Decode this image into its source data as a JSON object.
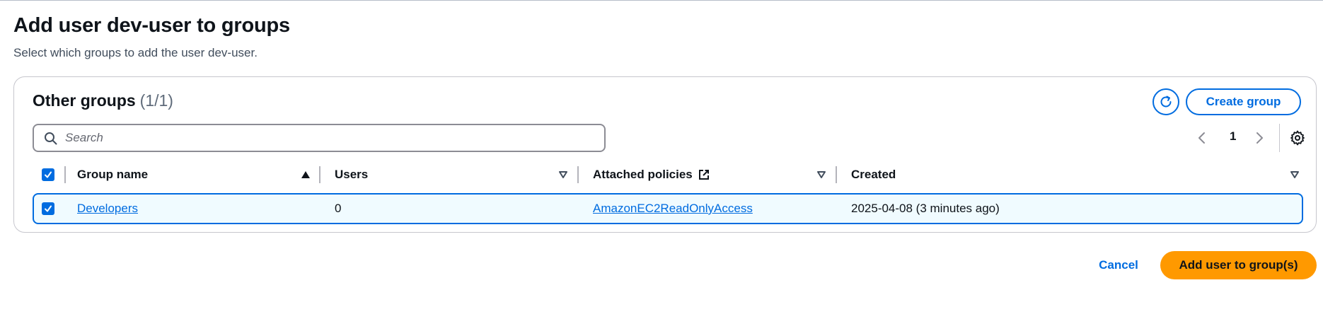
{
  "page": {
    "title": "Add user dev-user to groups",
    "description": "Select which groups to add the user dev-user."
  },
  "panel": {
    "title": "Other groups",
    "count": "(1/1)",
    "refresh_icon": "refresh-icon",
    "create_button": "Create group"
  },
  "search": {
    "placeholder": "Search",
    "value": ""
  },
  "pagination": {
    "current_page": "1",
    "prev_icon": "chevron-left-icon",
    "next_icon": "chevron-right-icon",
    "settings_icon": "gear-icon"
  },
  "table": {
    "columns": [
      {
        "label": "Group name",
        "sort": "ascending"
      },
      {
        "label": "Users",
        "sort": "none"
      },
      {
        "label": "Attached policies",
        "sort": "none",
        "icon": "external-link-icon"
      },
      {
        "label": "Created",
        "sort": "none"
      }
    ],
    "select_all_checked": true,
    "rows": [
      {
        "selected": true,
        "group_name": "Developers",
        "users": "0",
        "attached_policies": "AmazonEC2ReadOnlyAccess",
        "created": "2025-04-08 (3 minutes ago)"
      }
    ]
  },
  "footer": {
    "cancel_label": "Cancel",
    "submit_label": "Add user to group(s)"
  },
  "colors": {
    "link": "#006ce0",
    "primary_button": "#ff9900",
    "selected_row_bg": "#f0fbff",
    "text": "#0f141a"
  }
}
